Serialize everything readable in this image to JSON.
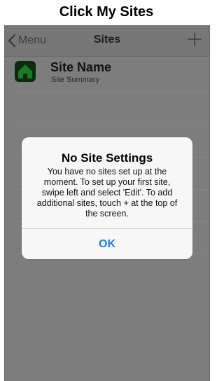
{
  "caption": "Click My Sites",
  "navbar": {
    "back_label": "Menu",
    "title": "Sites",
    "add_icon": "plus-icon"
  },
  "sites": [
    {
      "name": "Site Name",
      "summary": "Site Summary",
      "icon": "home-icon"
    }
  ],
  "alert": {
    "title": "No Site Settings",
    "message_lines": [
      "You have no sites set up at the",
      "moment.  To set up your first site,",
      "swipe left and select 'Edit'.  To add",
      "additional sites, touch + at the top of",
      "the screen."
    ],
    "ok_label": "OK"
  },
  "colors": {
    "alert_button": "#1a7df0",
    "site_icon_green": "#29b43a"
  }
}
